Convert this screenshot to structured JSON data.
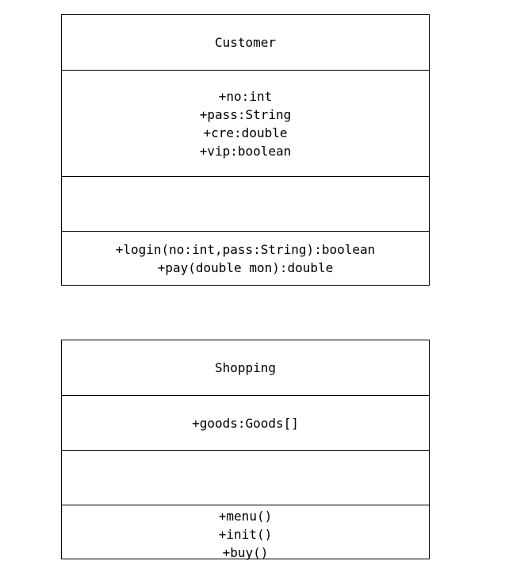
{
  "customer": {
    "name": "Customer",
    "attributes": [
      "+no:int",
      "+pass:String",
      "+cre:double",
      "+vip:boolean"
    ],
    "operations": [
      "+login(no:int,pass:String):boolean",
      "+pay(double mon):double"
    ]
  },
  "shopping": {
    "name": "Shopping",
    "attributes": [
      "+goods:Goods[]"
    ],
    "operations": [
      "+menu()",
      "+init()",
      "+buy()"
    ]
  }
}
